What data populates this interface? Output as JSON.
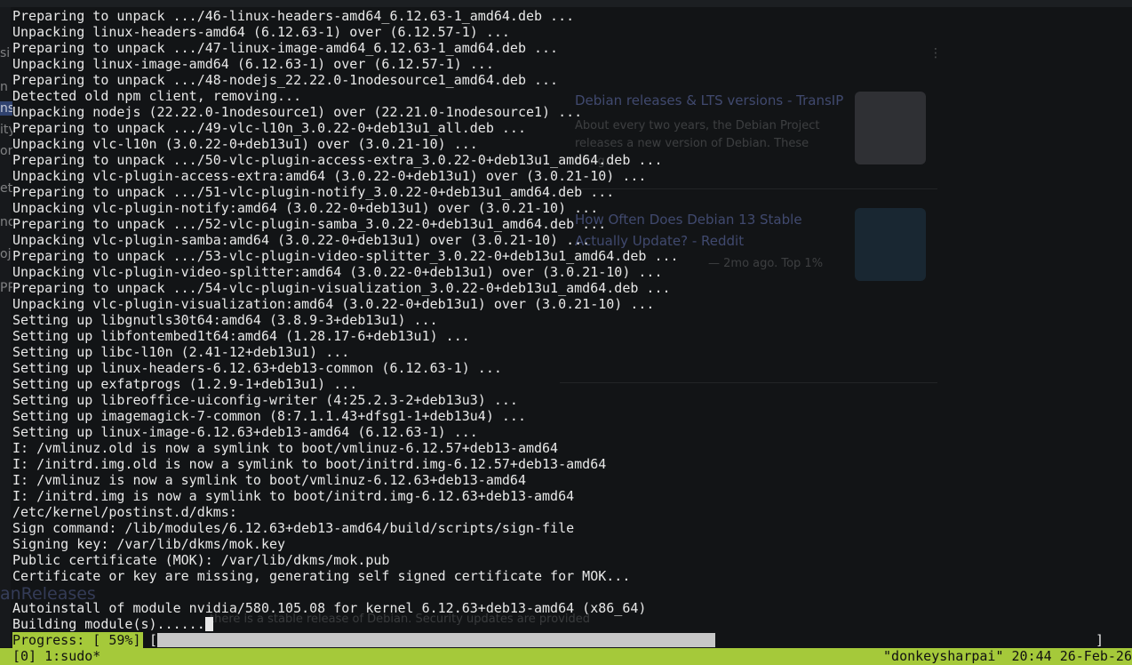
{
  "background": {
    "sidebar_fragments": [
      "si",
      "n",
      "ns",
      "ity",
      "on",
      "et",
      "no",
      "oj",
      "PP"
    ],
    "result_cards": [
      {
        "title": "Debian releases & LTS versions - TransIP",
        "snippet": "About every two years, the Debian Project releases a new version of Debian. These bring..."
      },
      {
        "title": "How Often Does Debian 13 Stable Actually Update? - Reddit",
        "snippet": "— 2mo ago. Top 1%"
      }
    ],
    "left_heading": "anReleases",
    "left_note": "there is a stable release of Debian. Security updates are provided"
  },
  "terminal": {
    "lines": [
      "Preparing to unpack .../46-linux-headers-amd64_6.12.63-1_amd64.deb ...",
      "Unpacking linux-headers-amd64 (6.12.63-1) over (6.12.57-1) ...",
      "Preparing to unpack .../47-linux-image-amd64_6.12.63-1_amd64.deb ...",
      "Unpacking linux-image-amd64 (6.12.63-1) over (6.12.57-1) ...",
      "Preparing to unpack .../48-nodejs_22.22.0-1nodesource1_amd64.deb ...",
      "Detected old npm client, removing...",
      "Unpacking nodejs (22.22.0-1nodesource1) over (22.21.0-1nodesource1) ...",
      "Preparing to unpack .../49-vlc-l10n_3.0.22-0+deb13u1_all.deb ...",
      "Unpacking vlc-l10n (3.0.22-0+deb13u1) over (3.0.21-10) ...",
      "Preparing to unpack .../50-vlc-plugin-access-extra_3.0.22-0+deb13u1_amd64.deb ...",
      "Unpacking vlc-plugin-access-extra:amd64 (3.0.22-0+deb13u1) over (3.0.21-10) ...",
      "Preparing to unpack .../51-vlc-plugin-notify_3.0.22-0+deb13u1_amd64.deb ...",
      "Unpacking vlc-plugin-notify:amd64 (3.0.22-0+deb13u1) over (3.0.21-10) ...",
      "Preparing to unpack .../52-vlc-plugin-samba_3.0.22-0+deb13u1_amd64.deb ...",
      "Unpacking vlc-plugin-samba:amd64 (3.0.22-0+deb13u1) over (3.0.21-10) ...",
      "Preparing to unpack .../53-vlc-plugin-video-splitter_3.0.22-0+deb13u1_amd64.deb ...",
      "Unpacking vlc-plugin-video-splitter:amd64 (3.0.22-0+deb13u1) over (3.0.21-10) ...",
      "Preparing to unpack .../54-vlc-plugin-visualization_3.0.22-0+deb13u1_amd64.deb ...",
      "Unpacking vlc-plugin-visualization:amd64 (3.0.22-0+deb13u1) over (3.0.21-10) ...",
      "Setting up libgnutls30t64:amd64 (3.8.9-3+deb13u1) ...",
      "Setting up libfontembed1t64:amd64 (1.28.17-6+deb13u1) ...",
      "Setting up libc-l10n (2.41-12+deb13u1) ...",
      "Setting up linux-headers-6.12.63+deb13-common (6.12.63-1) ...",
      "Setting up exfatprogs (1.2.9-1+deb13u1) ...",
      "Setting up libreoffice-uiconfig-writer (4:25.2.3-2+deb13u3) ...",
      "Setting up imagemagick-7-common (8:7.1.1.43+dfsg1-1+deb13u4) ...",
      "Setting up linux-image-6.12.63+deb13-amd64 (6.12.63-1) ...",
      "I: /vmlinuz.old is now a symlink to boot/vmlinuz-6.12.57+deb13-amd64",
      "I: /initrd.img.old is now a symlink to boot/initrd.img-6.12.57+deb13-amd64",
      "I: /vmlinuz is now a symlink to boot/vmlinuz-6.12.63+deb13-amd64",
      "I: /initrd.img is now a symlink to boot/initrd.img-6.12.63+deb13-amd64",
      "/etc/kernel/postinst.d/dkms:",
      "Sign command: /lib/modules/6.12.63+deb13-amd64/build/scripts/sign-file",
      "Signing key: /var/lib/dkms/mok.key",
      "Public certificate (MOK): /var/lib/dkms/mok.pub",
      "Certificate or key are missing, generating self signed certificate for MOK...",
      "",
      "Autoinstall of module nvidia/580.105.08 for kernel 6.12.63+deb13-amd64 (x86_64)",
      "Building module(s)......"
    ],
    "progress": {
      "label": "Progress: [ 59%]",
      "open_bracket": "[",
      "close_bracket": "]",
      "fraction": 0.59
    }
  },
  "statusbar": {
    "left": "[0] 1:sudo*",
    "right": "\"donkeysharpai\" 20:44 26-Feb-26"
  },
  "colors": {
    "terminal_bg": "#121416",
    "terminal_fg": "#e8e8e8",
    "status_bg": "#a5c93a",
    "progress_fill": "#c7c7c7"
  }
}
